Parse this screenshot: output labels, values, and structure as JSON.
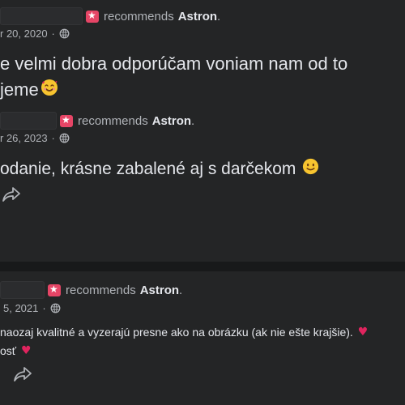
{
  "posts": [
    {
      "recommends_prefix": "recommends",
      "page_name": "Astron",
      "name_suffix": ".",
      "date": "r 20, 2020",
      "date_sep": "·",
      "text_line1": "e velmi dobra odporúčam voniam nam od to",
      "text_line2": "jeme",
      "emoji": "smiling-face-with-hearts"
    },
    {
      "recommends_prefix": "recommends",
      "page_name": "Astron",
      "name_suffix": ".",
      "date": "r 26, 2023",
      "date_sep": "·",
      "text_line1": "odanie, krásne zabalené aj s darčekom",
      "emoji": "slightly-smiling-face"
    },
    {
      "recommends_prefix": "recommends",
      "page_name": "Astron",
      "name_suffix": ".",
      "date": "5, 2021",
      "date_sep": "·",
      "text_line1": "naozaj kvalitné a vyzerajú presne ako na obrázku (ak nie ešte krajšie).",
      "text_line2": "osť",
      "heart": "♥"
    }
  ],
  "colors": {
    "background": "#18191a",
    "card": "#242526",
    "recommend_badge": "#e64566",
    "heart": "#e0245e"
  }
}
